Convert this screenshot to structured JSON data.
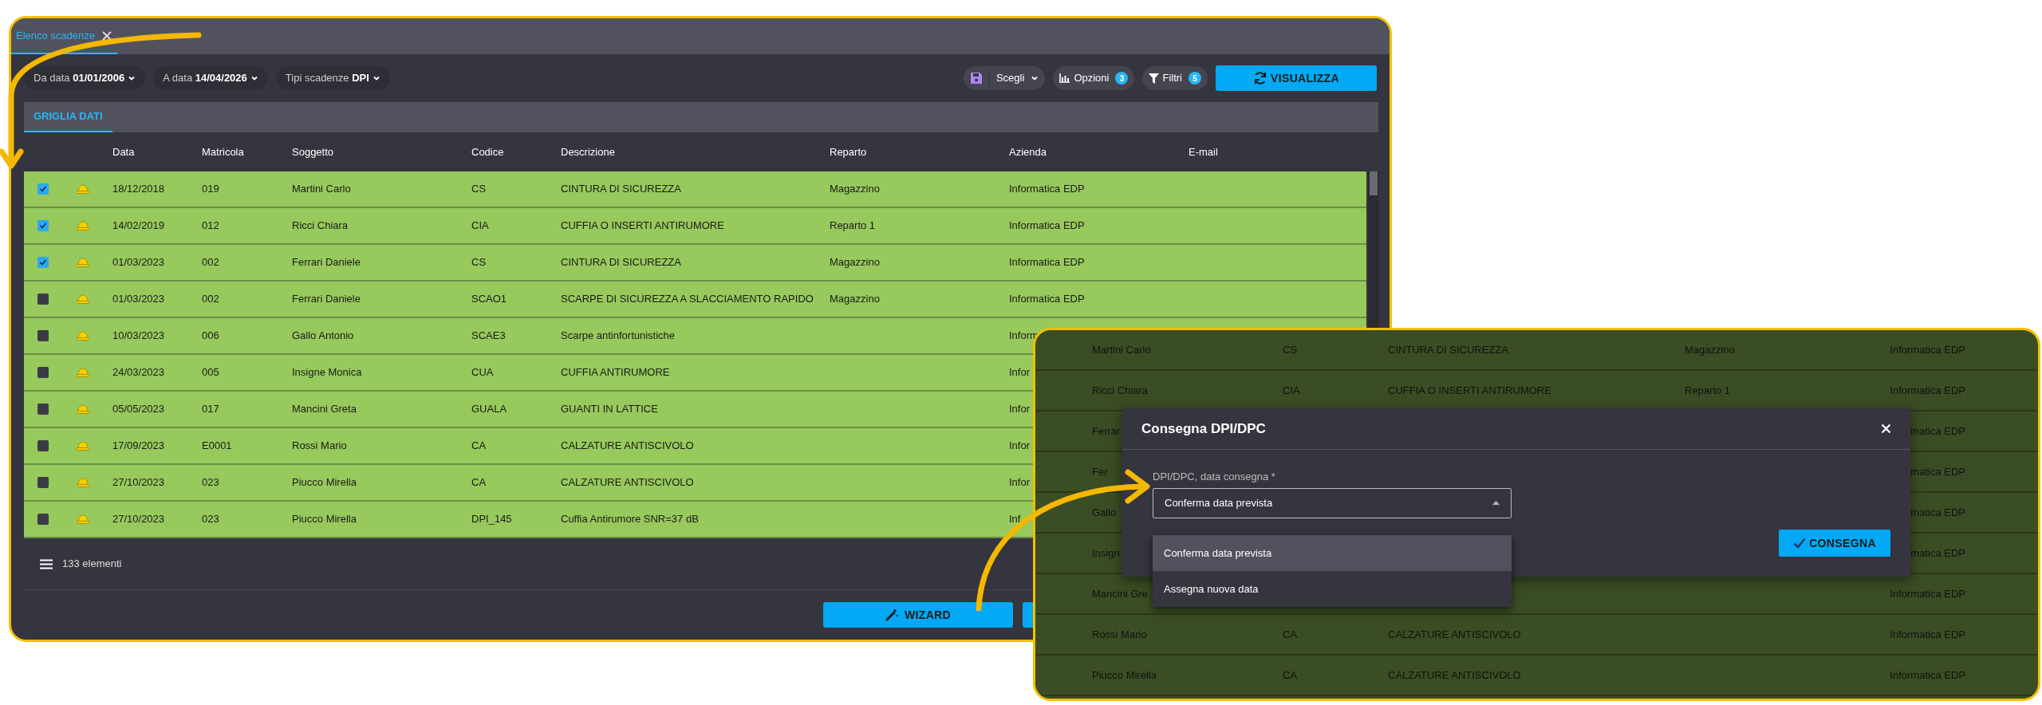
{
  "main_window": {
    "tab": {
      "label": "Elenco scadenze",
      "selected": true
    },
    "filters": [
      {
        "label": "Da data",
        "value": "01/01/2006"
      },
      {
        "label": "A data",
        "value": "14/04/2026"
      },
      {
        "label": "Tipi scadenze",
        "value": "DPI"
      }
    ],
    "toolbar": [
      {
        "kind": "save",
        "label": "Scegli"
      },
      {
        "kind": "options",
        "label": "Opzioni",
        "count": "3"
      },
      {
        "kind": "filter",
        "label": "Filtri",
        "count": "5"
      },
      {
        "kind": "primary",
        "label": "VISUALIZZA"
      }
    ],
    "view_tab": {
      "label": "GRIGLIA DATI",
      "selected": true
    },
    "table": {
      "columns": [
        "Data",
        "Matricola",
        "Soggetto",
        "Codice",
        "Descrizione",
        "Reparto",
        "Azienda",
        "E-mail"
      ],
      "rows": [
        {
          "checked": true,
          "data": "18/12/2018",
          "matricola": "019",
          "soggetto": "Martini Carlo",
          "codice": "CS",
          "descrizione": "CINTURA DI SICUREZZA",
          "reparto": "Magazzino",
          "azienda": "Informatica EDP"
        },
        {
          "checked": true,
          "data": "14/02/2019",
          "matricola": "012",
          "soggetto": "Ricci Chiara",
          "codice": "CIA",
          "descrizione": "CUFFIA O INSERTI ANTIRUMORE",
          "reparto": "Reparto 1",
          "azienda": "Informatica EDP"
        },
        {
          "checked": true,
          "data": "01/03/2023",
          "matricola": "002",
          "soggetto": "Ferrari Daniele",
          "codice": "CS",
          "descrizione": "CINTURA DI SICUREZZA",
          "reparto": "Magazzino",
          "azienda": "Informatica EDP"
        },
        {
          "checked": false,
          "data": "01/03/2023",
          "matricola": "002",
          "soggetto": "Ferrari Daniele",
          "codice": "SCAO1",
          "descrizione": "SCARPE DI SICUREZZA A SLACCIAMENTO RAPIDO",
          "reparto": "Magazzino",
          "azienda": "Informatica EDP"
        },
        {
          "checked": false,
          "data": "10/03/2023",
          "matricola": "006",
          "soggetto": "Gallo Antonio",
          "codice": "SCAE3",
          "descrizione": "Scarpe antinfortunistiche",
          "azienda": "Inform"
        },
        {
          "checked": false,
          "data": "24/03/2023",
          "matricola": "005",
          "soggetto": "Insigne Monica",
          "codice": "CUA",
          "descrizione": "CUFFIA ANTIRUMORE",
          "azienda": "Infor"
        },
        {
          "checked": false,
          "data": "05/05/2023",
          "matricola": "017",
          "soggetto": "Mancini Greta",
          "codice": "GUALA",
          "descrizione": "GUANTI IN LATTICE",
          "azienda": "Infor"
        },
        {
          "checked": false,
          "data": "17/09/2023",
          "matricola": "E0001",
          "soggetto": "Rossi Mario",
          "codice": "CA",
          "descrizione": "CALZATURE ANTISCIVOLO",
          "azienda": "Infor"
        },
        {
          "checked": false,
          "data": "27/10/2023",
          "matricola": "023",
          "soggetto": "Piucco Mirella",
          "codice": "CA",
          "descrizione": "CALZATURE ANTISCIVOLO",
          "azienda": "Infor"
        },
        {
          "checked": false,
          "data": "27/10/2023",
          "matricola": "023",
          "soggetto": "Piucco Mirella",
          "codice": "DPI_145",
          "descrizione": "Cuffia Antirumore SNR=37 dB",
          "azienda": "Inf"
        }
      ]
    },
    "footer": {
      "count": "133 elementi"
    },
    "buttons": [
      {
        "kind": "wizard",
        "label": "WIZARD"
      },
      {
        "kind": "blank"
      }
    ]
  },
  "detail_window": {
    "rows": [
      {
        "soggetto": "Martini Carlo",
        "codice": "CS",
        "descrizione": "CINTURA DI SICUREZZA",
        "reparto": "Magazzino",
        "azienda": "Informatica EDP"
      },
      {
        "soggetto": "Ricci Chiara",
        "codice": "CIA",
        "descrizione": "CUFFIA O INSERTI ANTIRUMORE",
        "reparto": "Reparto 1",
        "azienda": "Informatica EDP"
      },
      {
        "soggetto": "Ferrar",
        "azienda": "matica EDP"
      },
      {
        "soggetto": "Fer",
        "azienda": "matica EDP"
      },
      {
        "soggetto": "Gallo",
        "azienda": "matica EDP"
      },
      {
        "soggetto": "Insign",
        "azienda": "matica EDP"
      },
      {
        "soggetto": "Mancini Gre",
        "azienda": "Informatica EDP"
      },
      {
        "soggetto": "Rossi Mario",
        "codice": "CA",
        "descrizione": "CALZATURE ANTISCIVOLO",
        "azienda": "Informatica EDP"
      },
      {
        "soggetto": "Piucco Mirella",
        "codice": "CA",
        "descrizione": "CALZATURE ANTISCIVOLO",
        "azienda": "Informatica EDP"
      }
    ],
    "dialog": {
      "title": "Consegna DPI/DPC",
      "field": {
        "label": "DPI/DPC, data consegna *",
        "value": "Conferma data prevista",
        "expanded": true
      },
      "options": [
        {
          "label": "Conferma data prevista",
          "selected": true
        },
        {
          "label": "Assegna nuova data",
          "selected": false
        }
      ],
      "confirm": "CONSEGNA"
    }
  }
}
